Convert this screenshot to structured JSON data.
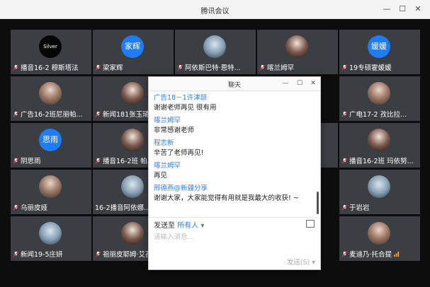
{
  "window": {
    "title": "腾讯会议",
    "min": "—",
    "max": "☐",
    "close": "✕"
  },
  "tiles": [
    {
      "name": "播音16-2 穆斯塔法",
      "avatar": "Silver"
    },
    {
      "name": "梁家辉",
      "avatar": "家辉"
    },
    {
      "name": "阿依斯巴特·恩特...",
      "avatar": ""
    },
    {
      "name": "喀兰姆罕",
      "avatar": ""
    },
    {
      "name": "19专硕霍媛媛",
      "avatar": "媛媛"
    },
    {
      "name": "广告16-2班尼丽帕...",
      "avatar": ""
    },
    {
      "name": "新闻181张玉琦",
      "avatar": ""
    },
    {
      "name": "广电17-2 孜比拉...",
      "avatar": ""
    },
    {
      "name": "阴思雨",
      "avatar": "思雨"
    },
    {
      "name": "播音16-2班 帕...",
      "avatar": ""
    },
    {
      "name": "...",
      "avatar": ""
    },
    {
      "name": "播音16-2班 玛依努...",
      "avatar": ""
    },
    {
      "name": "乌丽皮娅",
      "avatar": ""
    },
    {
      "name": "16-2播音阿依娜...",
      "avatar": ""
    },
    {
      "name": "于岩岩",
      "avatar": ""
    },
    {
      "name": "新闻19-5庄妍",
      "avatar": ""
    },
    {
      "name": "祖丽皮耶姆·艾孜...",
      "avatar": ""
    },
    {
      "name": "麦迪乃·托合提",
      "avatar": ""
    }
  ],
  "chat": {
    "title": "聊天",
    "messages": [
      {
        "sender": "广告18－1许津颉",
        "text": "谢谢老师再见 很有用"
      },
      {
        "sender": "喀兰姆罕",
        "text": "非常感谢老师"
      },
      {
        "sender": "程志新",
        "text": "辛苦了老师再见!"
      },
      {
        "sender": "喀兰姆罕",
        "text": "再见"
      },
      {
        "sender": "邢德燕@新疆分享",
        "text": "谢谢大家，大家能觉得有用就是我最大的收获! ~"
      }
    ],
    "send_to_label": "发送至",
    "send_to_target": "所有人",
    "input_placeholder": "请输入消息...",
    "send_button": "发送(S)"
  }
}
